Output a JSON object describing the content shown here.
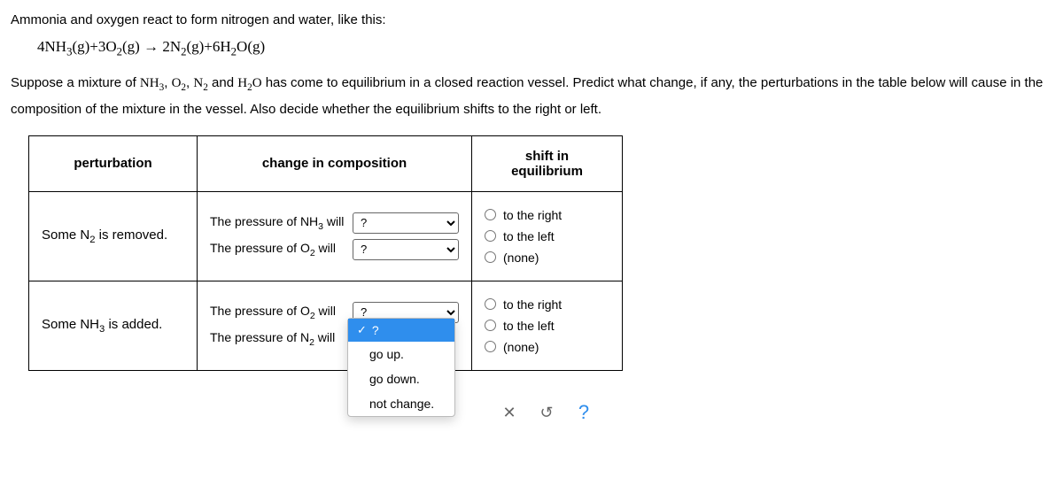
{
  "intro": "Ammonia and oxygen react to form nitrogen and water, like this:",
  "equation_html": "4NH<sub>3</sub>(g)+3O<sub>2</sub>(g)&nbsp;&rarr;&nbsp;2N<sub>2</sub>(g)+6H<sub>2</sub>O(g)",
  "paragraph_html": "Suppose a mixture of <span class='serif'>NH<sub>3</sub></span>, <span class='serif'>O<sub>2</sub></span>, <span class='serif'>N<sub>2</sub></span> and <span class='serif'>H<sub>2</sub>O</span> has come to equilibrium in a closed reaction vessel. Predict what change, if any, the perturbations in the table below will cause in the composition of the mixture in the vessel. Also decide whether the equilibrium shifts to the right or left.",
  "headers": {
    "perturbation": "perturbation",
    "change": "change in composition",
    "shift": "shift in equilibrium"
  },
  "rows": [
    {
      "perturbation_html": "Some N<sub>2</sub> is removed.",
      "changes": [
        {
          "label_html": "The pressure of NH<sub>3</sub> will",
          "value": "?"
        },
        {
          "label_html": "The pressure of O<sub>2</sub> will",
          "value": "?"
        }
      ]
    },
    {
      "perturbation_html": "Some NH<sub>3</sub> is added.",
      "changes": [
        {
          "label_html": "The pressure of O<sub>2</sub> will",
          "value": "?"
        },
        {
          "label_html": "The pressure of N<sub>2</sub> will",
          "value": "?"
        }
      ]
    }
  ],
  "shift_options": {
    "right": "to the right",
    "left": "to the left",
    "none": "(none)"
  },
  "dropdown": {
    "selected": "?",
    "options": [
      "go up.",
      "go down.",
      "not change."
    ]
  },
  "actions": {
    "close": "✕",
    "reset": "↺",
    "help": "?"
  }
}
